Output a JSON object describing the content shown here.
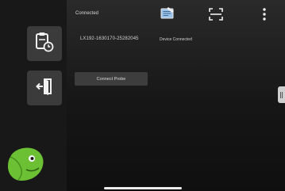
{
  "header": {
    "status_text": "Connected",
    "icons": [
      "document-edit-icon",
      "scan-icon",
      "more-vertical-icon"
    ]
  },
  "sidebar": {
    "items": [
      {
        "name": "history",
        "icon": "clipboard-clock-icon"
      },
      {
        "name": "exit",
        "icon": "exit-door-icon"
      }
    ]
  },
  "device": {
    "id": "LX192-1630170-25282045",
    "status": "Device Connected"
  },
  "actions": {
    "connect_probe_label": "Connect Probe"
  },
  "colors": {
    "background": "#1c1c1c",
    "button": "#3d3d3d",
    "logo_green": "#6cc033"
  }
}
